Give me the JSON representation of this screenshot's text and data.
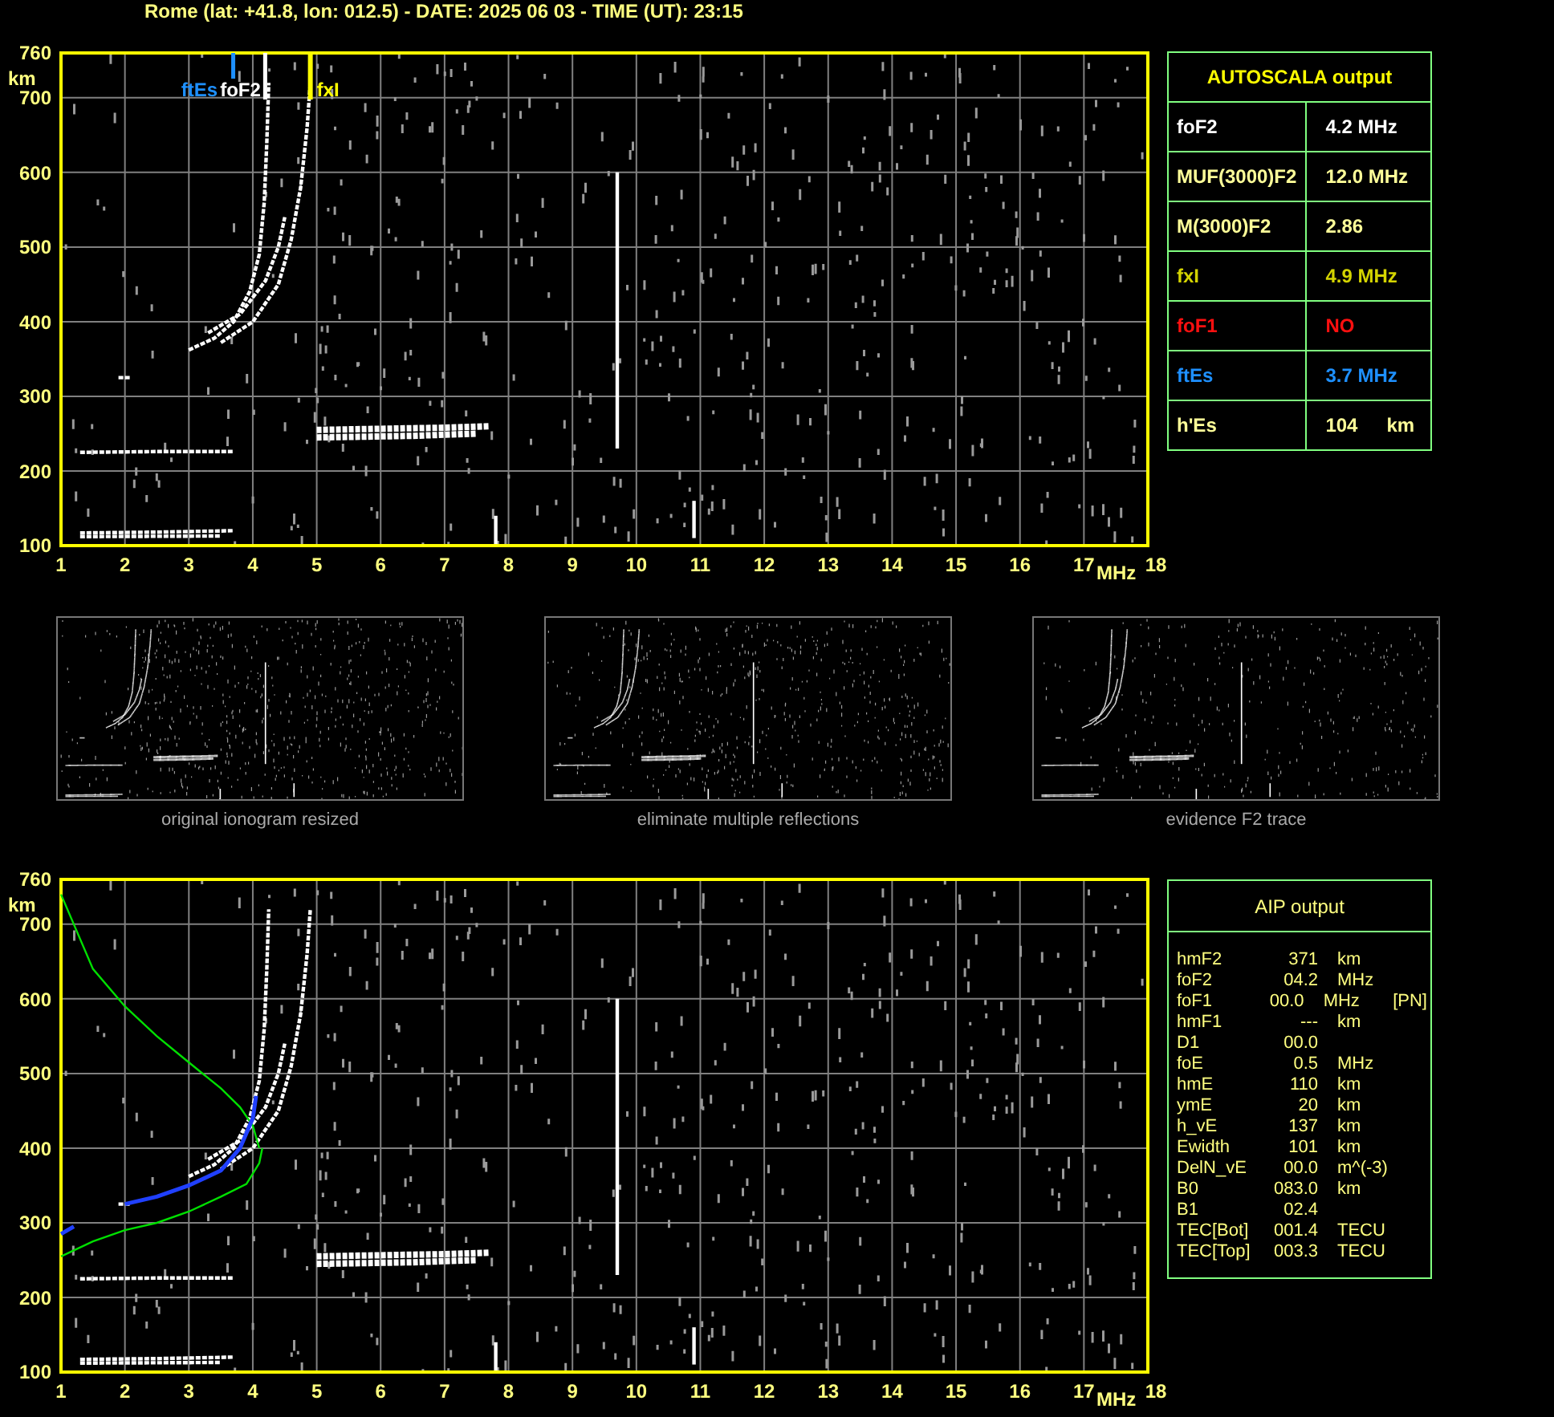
{
  "header": {
    "title": "Rome (lat: +41.8, lon: 012.5) - DATE: 2025 06 03 - TIME (UT): 23:15"
  },
  "top_chart": {
    "y_unit": "km",
    "x_unit": "MHz",
    "y_labels": [
      "760",
      "700",
      "600",
      "500",
      "400",
      "300",
      "200",
      "100"
    ],
    "x_labels": [
      "1",
      "2",
      "3",
      "4",
      "5",
      "6",
      "7",
      "8",
      "9",
      "10",
      "11",
      "12",
      "13",
      "14",
      "15",
      "16",
      "17",
      "18"
    ],
    "markers": [
      {
        "label": "ftEs",
        "color": "#1e90ff"
      },
      {
        "label": "foF2",
        "color": "#ffffff"
      },
      {
        "label": "fxI",
        "color": "#ffff00"
      }
    ]
  },
  "autoscala": {
    "title": "AUTOSCALA output",
    "rows": [
      {
        "name": "foF2",
        "value": "4.2 MHz",
        "color": "#ffffff"
      },
      {
        "name": "MUF(3000)F2",
        "value": "12.0 MHz",
        "color": "#ffff99"
      },
      {
        "name": "M(3000)F2",
        "value": "2.86",
        "color": "#ffff99"
      },
      {
        "name": "fxI",
        "value": "4.9 MHz",
        "color": "#d4d400"
      },
      {
        "name": "foF1",
        "value": "NO",
        "color": "#ff1010"
      },
      {
        "name": "ftEs",
        "value": "3.7 MHz",
        "color": "#1e90ff"
      },
      {
        "name": "h'Es",
        "value": "104",
        "unit": "km",
        "color": "#ffff99"
      }
    ]
  },
  "thumbnails": [
    {
      "caption": "original ionogram resized"
    },
    {
      "caption": "eliminate multiple reflections"
    },
    {
      "caption": "evidence F2 trace"
    }
  ],
  "bottom_chart": {
    "y_unit": "km",
    "x_unit": "MHz",
    "y_labels": [
      "760",
      "700",
      "600",
      "500",
      "400",
      "300",
      "200",
      "100"
    ],
    "x_labels": [
      "1",
      "2",
      "3",
      "4",
      "5",
      "6",
      "7",
      "8",
      "9",
      "10",
      "11",
      "12",
      "13",
      "14",
      "15",
      "16",
      "17",
      "18"
    ]
  },
  "aip": {
    "title": "AIP output",
    "rows": [
      {
        "name": "hmF2",
        "value": "371",
        "unit": "km"
      },
      {
        "name": "foF2",
        "value": "04.2",
        "unit": "MHz"
      },
      {
        "name": "foF1",
        "value": "00.0",
        "unit": "MHz",
        "note": "[PN]"
      },
      {
        "name": "hmF1",
        "value": "---",
        "unit": "km"
      },
      {
        "name": "D1",
        "value": "00.0"
      },
      {
        "name": "foE",
        "value": "0.5",
        "unit": "MHz"
      },
      {
        "name": "hmE",
        "value": "110",
        "unit": "km"
      },
      {
        "name": "ymE",
        "value": "20",
        "unit": "km"
      },
      {
        "name": "h_vE",
        "value": "137",
        "unit": "km"
      },
      {
        "name": "Ewidth",
        "value": "101",
        "unit": "km"
      },
      {
        "name": "DelN_vE",
        "value": "00.0",
        "unit": "m^(-3)"
      },
      {
        "name": "B0",
        "value": "083.0",
        "unit": "km"
      },
      {
        "name": "B1",
        "value": "02.4"
      },
      {
        "name": "TEC[Bot]",
        "value": "001.4",
        "unit": "TECU"
      },
      {
        "name": "TEC[Top]",
        "value": "003.3",
        "unit": "TECU"
      }
    ]
  }
}
